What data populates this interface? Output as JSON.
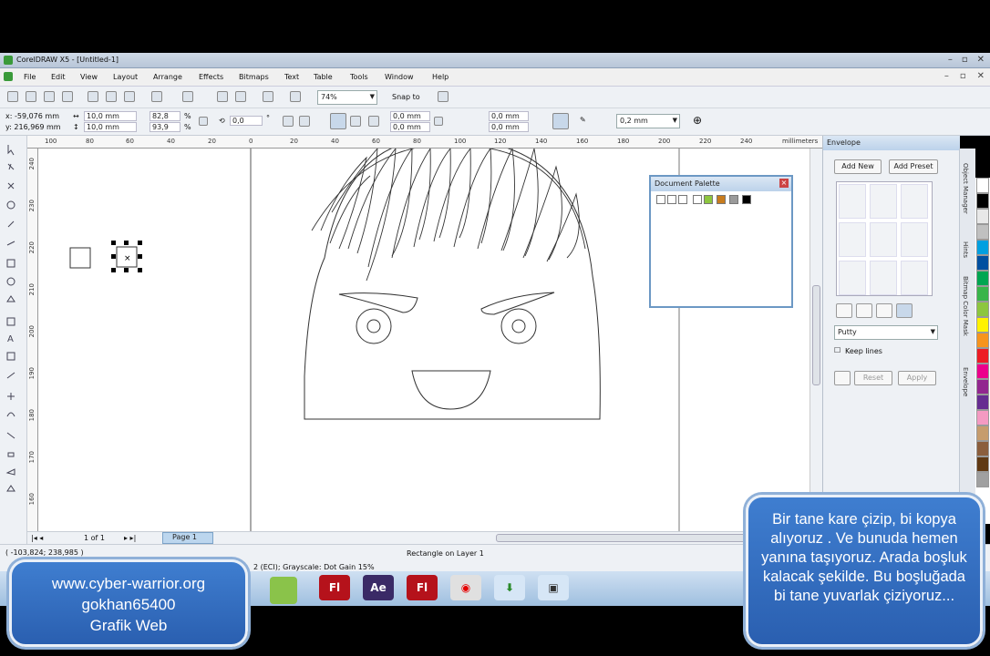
{
  "window": {
    "title": "CorelDRAW X5 - [Untitled-1]"
  },
  "menu": [
    "File",
    "Edit",
    "View",
    "Layout",
    "Arrange",
    "Effects",
    "Bitmaps",
    "Text",
    "Table",
    "Tools",
    "Window",
    "Help"
  ],
  "standard_toolbar": {
    "zoom": "74%",
    "snap_to": "Snap to"
  },
  "property_bar": {
    "x": "x: -59,076 mm",
    "y": "y: 216,969 mm",
    "width": "10,0 mm",
    "height": "10,0 mm",
    "scale_w": "82,8",
    "scale_h": "93,9",
    "pct": "%",
    "angle": "0,0",
    "deg": "°",
    "corner_1": "0,0 mm",
    "corner_2": "0,0 mm",
    "corner_3": "0,0 mm",
    "corner_4": "0,0 mm",
    "outline": "0,2 mm"
  },
  "ruler": {
    "h_ticks": [
      "100",
      "80",
      "60",
      "40",
      "20",
      "0",
      "20",
      "40",
      "60",
      "80",
      "100",
      "120",
      "140",
      "160",
      "180",
      "200",
      "220",
      "240"
    ],
    "units": "millimeters",
    "v_ticks": [
      "240",
      "230",
      "220",
      "210",
      "200",
      "190",
      "180",
      "170",
      "160"
    ]
  },
  "document_palette": {
    "title": "Document Palette",
    "swatches": [
      "#ffffff",
      "#8dc63f",
      "#c87c1e",
      "#9a9a9a",
      "#000000"
    ]
  },
  "docker": {
    "title": "Envelope",
    "add_new": "Add New",
    "add_preset": "Add Preset",
    "mode": "Putty",
    "keep_lines": "Keep lines",
    "reset": "Reset",
    "apply": "Apply",
    "side_tabs": [
      "Object Manager",
      "Hints",
      "Bitmap Color Mask",
      "Envelope"
    ]
  },
  "color_palette": [
    "#ffffff",
    "#000000",
    "#e8e8e8",
    "#c0c0c0",
    "#00a0e0",
    "#0050a0",
    "#00a651",
    "#39b54a",
    "#8dc63f",
    "#fff200",
    "#f7941d",
    "#ed1c24",
    "#ec008c",
    "#92278f",
    "#662d91",
    "#f49ac2",
    "#c69c6d",
    "#8b5e3c",
    "#603913",
    "#a0a0a0"
  ],
  "pagebar": {
    "page_counter": "1 of 1",
    "page_tab": "Page 1"
  },
  "status": {
    "coords": "( -103,824; 238,985 )",
    "object": "Rectangle on Layer 1",
    "color_profile": "2 (ECI); Grayscale: Dot Gain 15%"
  },
  "taskbar": [
    {
      "name": "flash",
      "label": "Fl",
      "color": "#b5121b"
    },
    {
      "name": "after-effects",
      "label": "Ae",
      "color": "#3a2a66"
    },
    {
      "name": "flash-2",
      "label": "Fl",
      "color": "#b5121b"
    },
    {
      "name": "vodafone",
      "label": "",
      "color": "#e0e0e0"
    },
    {
      "name": "download-manager",
      "label": "",
      "color": "#d6e6f6"
    },
    {
      "name": "video-tool",
      "label": "",
      "color": "#d6e6f6"
    }
  ],
  "overlay_left": {
    "line1": "www.cyber-warrior.org",
    "line2": "gokhan65400",
    "line3": "Grafik Web"
  },
  "overlay_right": {
    "text": "Bir tane kare çizip, bi kopya alıyoruz . Ve bunuda hemen yanına taşıyoruz. Arada boşluk kalacak şekilde. Bu boşluğada bi tane yuvarlak çiziyoruz..."
  }
}
